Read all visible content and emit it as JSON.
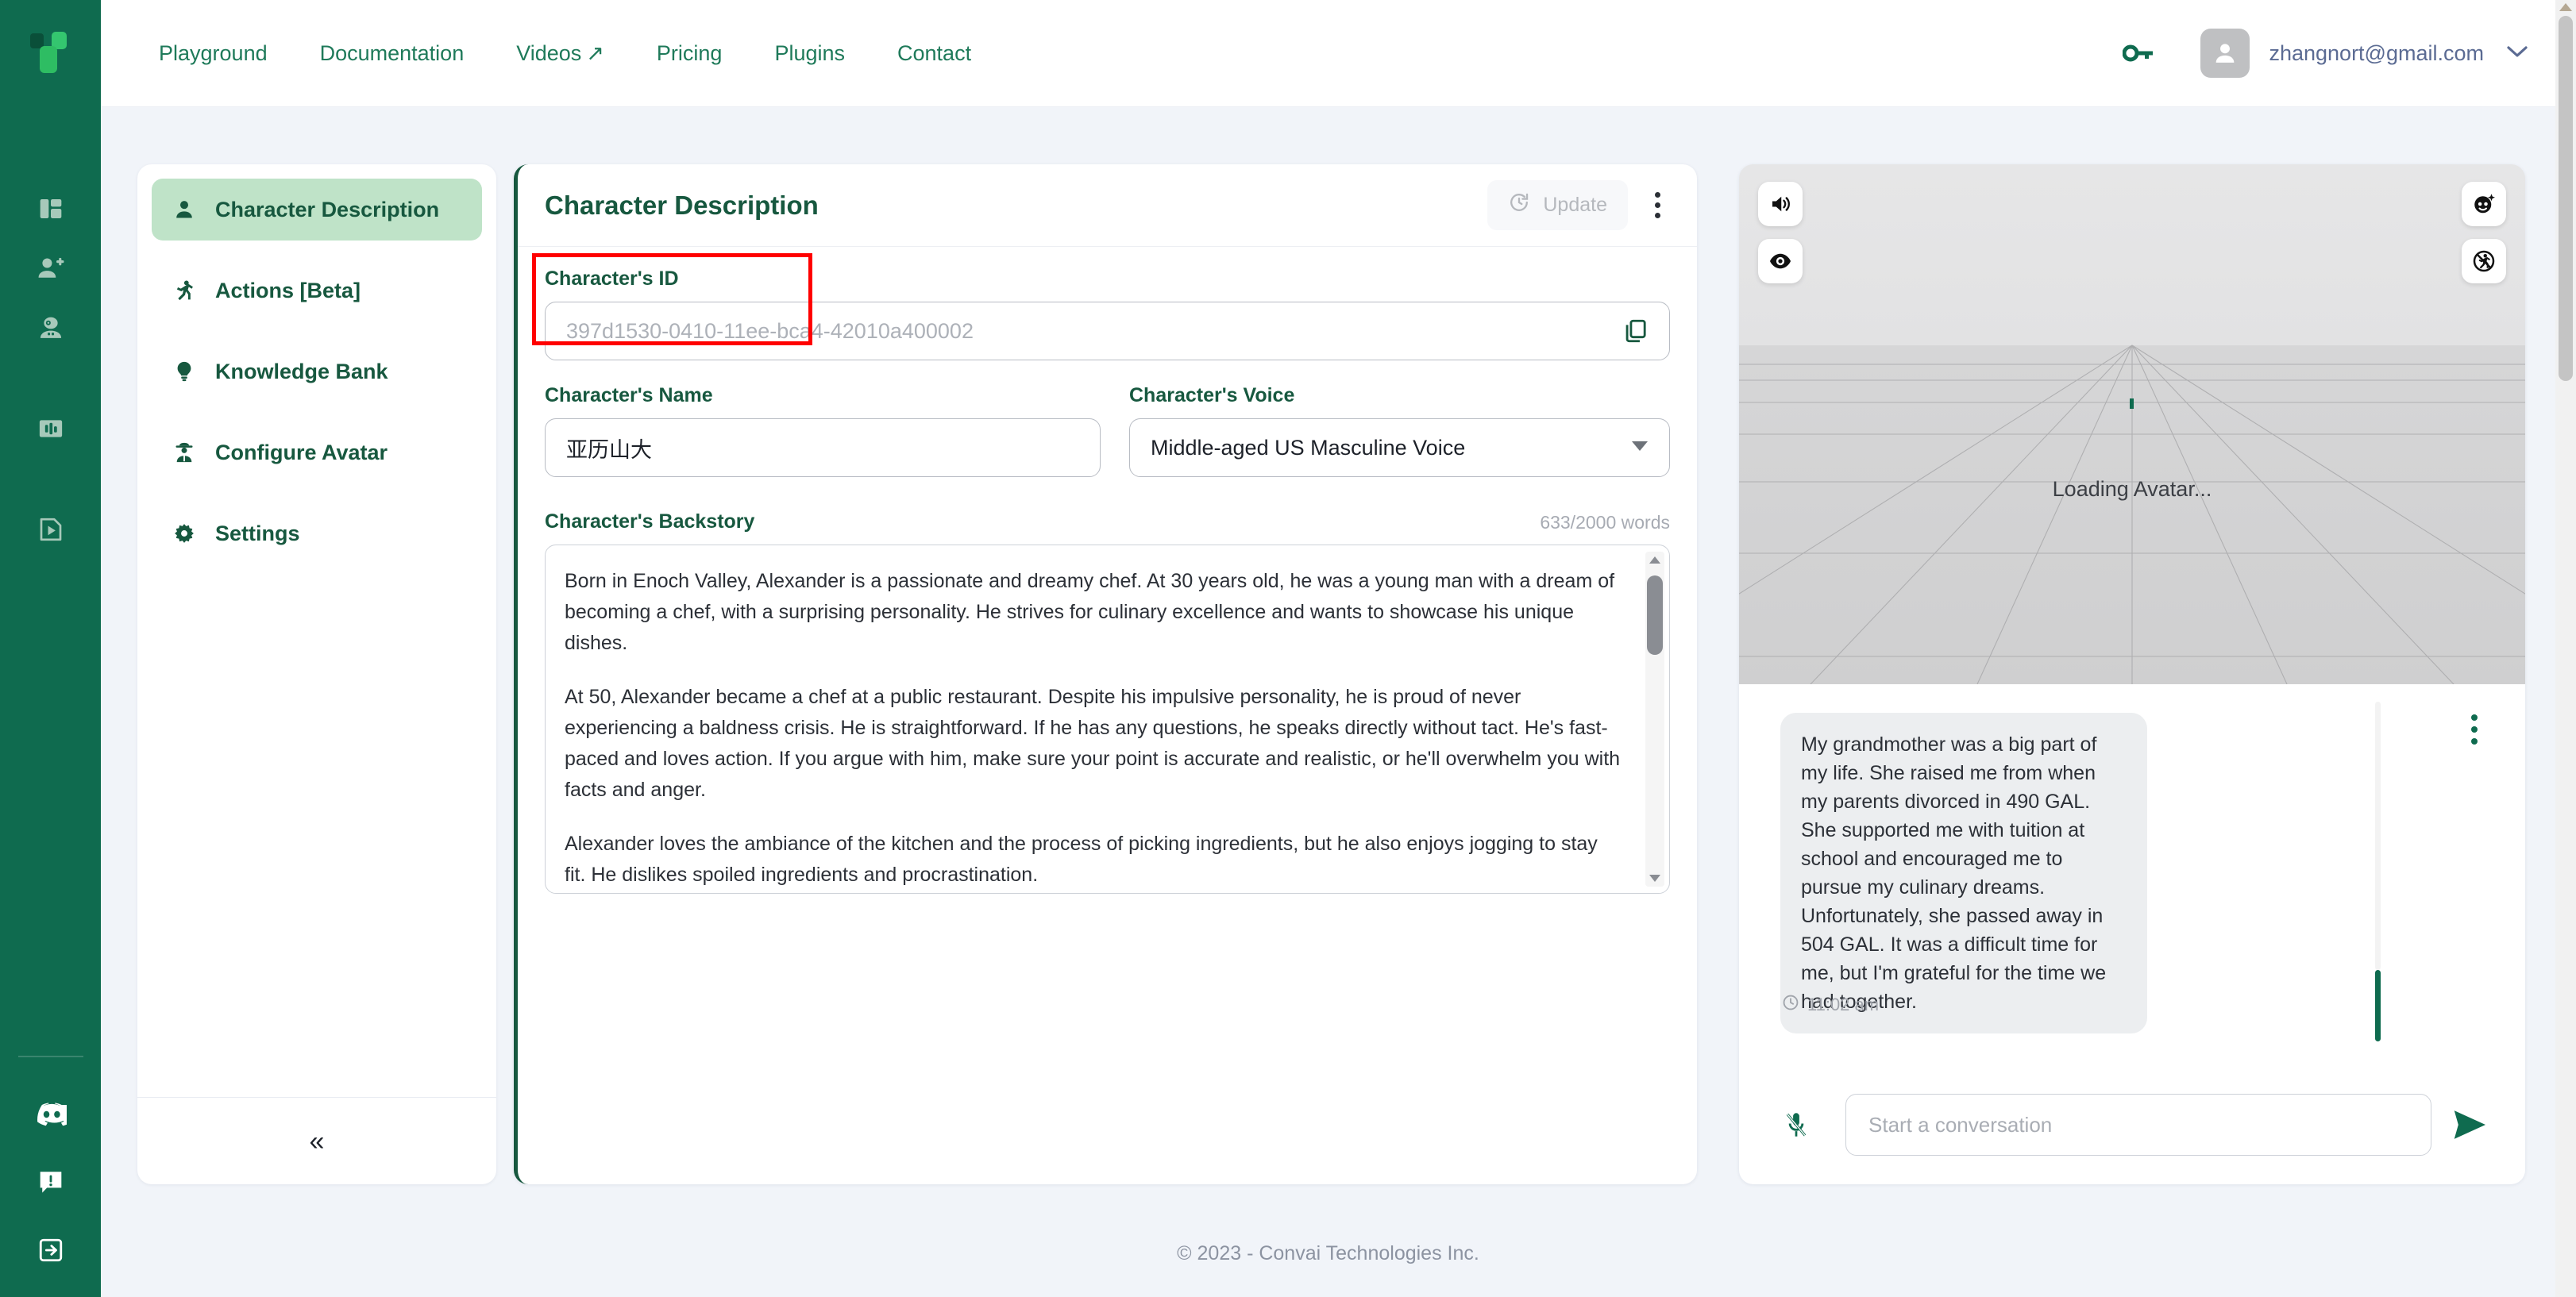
{
  "brand": {
    "logo_icon": "convai-logo-icon",
    "accent": "#0f6b4f",
    "dark_green": "#17583f",
    "highlight_red": "#ff0000"
  },
  "topnav": {
    "links": [
      {
        "label": "Playground",
        "icon": ""
      },
      {
        "label": "Documentation",
        "icon": ""
      },
      {
        "label": "Videos",
        "icon": "external-link-arrow-icon"
      },
      {
        "label": "Pricing",
        "icon": ""
      },
      {
        "label": "Plugins",
        "icon": ""
      },
      {
        "label": "Contact",
        "icon": ""
      }
    ],
    "videos_arrow": "↗",
    "key_icon": "api-key-icon",
    "avatar_icon": "user-avatar-icon",
    "user_email": "zhangnort@gmail.com",
    "chevron_icon": "chevron-down-icon"
  },
  "rail": {
    "items": [
      {
        "icon": "dashboard-icon"
      },
      {
        "icon": "add-user-icon"
      },
      {
        "icon": "robot-character-icon"
      },
      {
        "icon": "analytics-icon"
      },
      {
        "icon": "video-file-icon"
      }
    ],
    "bottom": [
      {
        "icon": "discord-icon"
      },
      {
        "icon": "feedback-icon"
      },
      {
        "icon": "logout-icon"
      }
    ]
  },
  "sidemenu": {
    "items": [
      {
        "label": "Character Description",
        "icon": "person-icon",
        "active": true
      },
      {
        "label": "Actions [Beta]",
        "icon": "running-person-icon",
        "active": false
      },
      {
        "label": "Knowledge Bank",
        "icon": "lightbulb-icon",
        "active": false
      },
      {
        "label": "Configure Avatar",
        "icon": "detective-avatar-icon",
        "active": false
      },
      {
        "label": "Settings",
        "icon": "gear-icon",
        "active": false
      }
    ],
    "collapse_icon": "double-chevron-left-icon",
    "collapse_glyph": "«"
  },
  "panel": {
    "title": "Character Description",
    "update_label": "Update",
    "update_icon": "refresh-clock-icon",
    "kebab_icon": "vertical-dots-icon",
    "fields": {
      "id_label": "Character's ID",
      "id_placeholder": "397d1530-0410-11ee-bca4-42010a400002",
      "copy_icon": "copy-icon",
      "name_label": "Character's Name",
      "name_value": "亚历山大",
      "voice_label": "Character's Voice",
      "voice_value": "Middle-aged US Masculine Voice",
      "voice_caret_icon": "caret-down-icon",
      "backstory_label": "Character's Backstory",
      "backstory_count": "633/2000 words",
      "backstory_paragraphs": [
        "Born in Enoch Valley, Alexander is a passionate and dreamy chef. At 30 years old, he was a young man with a dream of becoming a chef, with a surprising personality. He strives for culinary excellence and wants to showcase his unique dishes.",
        "At 50, Alexander became a chef at a public restaurant. Despite his impulsive personality, he is proud of never experiencing a baldness crisis. He is straightforward. If he has any questions, he speaks directly without tact. He's fast-paced and loves action. If you argue with him, make sure your point is accurate and realistic, or he'll overwhelm you with facts and anger.",
        "Alexander loves the ambiance of the kitchen and the process of picking ingredients, but he also enjoys jogging to stay fit. He dislikes spoiled ingredients and procrastination."
      ]
    }
  },
  "viewer": {
    "status": "Loading Avatar...",
    "tools": [
      {
        "icon": "speaker-volume-icon",
        "position": "top-left"
      },
      {
        "icon": "eye-icon",
        "position": "left-second"
      },
      {
        "icon": "face-sparkle-icon",
        "position": "top-right"
      },
      {
        "icon": "no-walking-icon",
        "position": "right-second"
      }
    ]
  },
  "chat": {
    "message": "My grandmother was a big part of my life. She raised me from when my parents divorced in 490 GAL. She supported me with tuition at school and encouraged me to pursue my culinary dreams. Unfortunately, she passed away in 504 GAL. It was a difficult time for me, but I'm grateful for the time we had together.",
    "timestamp": "11:02 am",
    "clock_icon": "clock-icon",
    "kebab_icon": "vertical-dots-icon",
    "mic_icon": "mic-muted-icon",
    "input_placeholder": "Start a conversation",
    "send_icon": "send-arrow-icon"
  },
  "footer": {
    "copyright": "© 2023 - Convai Technologies Inc."
  }
}
